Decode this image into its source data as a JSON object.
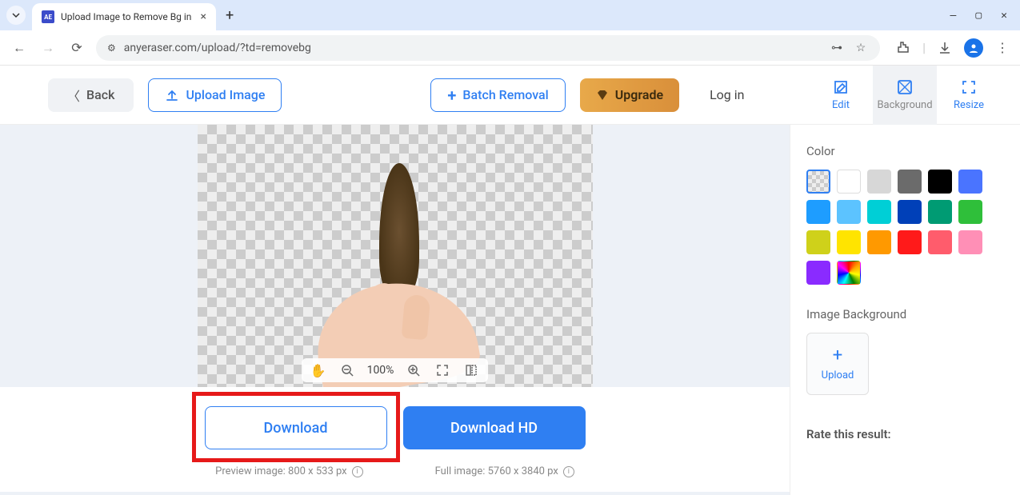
{
  "browser": {
    "tab_title": "Upload Image to Remove Bg in",
    "tab_favicon": "AE",
    "url": "anyeraser.com/upload/?td=removebg"
  },
  "header": {
    "back": "Back",
    "upload_image": "Upload Image",
    "batch_removal": "Batch Removal",
    "upgrade": "Upgrade",
    "login": "Log in",
    "tools": {
      "edit": "Edit",
      "background": "Background",
      "resize": "Resize"
    }
  },
  "canvas": {
    "zoom": "100%"
  },
  "downloads": {
    "download": "Download",
    "download_hd": "Download HD",
    "preview_label": "Preview image: 800 x 533 px",
    "full_label": "Full image: 5760 x 3840 px"
  },
  "side": {
    "color_heading": "Color",
    "bg_heading": "Image Background",
    "upload": "Upload",
    "rate_heading": "Rate this result:",
    "colors": [
      "transparent",
      "#ffffff",
      "#d7d7d7",
      "#6b6b6b",
      "#000000",
      "#4a74ff",
      "#1e9dff",
      "#5cc3ff",
      "#00cfd6",
      "#0040b8",
      "#009b73",
      "#2fbf3a",
      "#cfd11a",
      "#ffe400",
      "#ff9900",
      "#ff1a1a",
      "#ff5c6c",
      "#ff8fb6",
      "#8a2bff",
      "rainbow"
    ]
  }
}
